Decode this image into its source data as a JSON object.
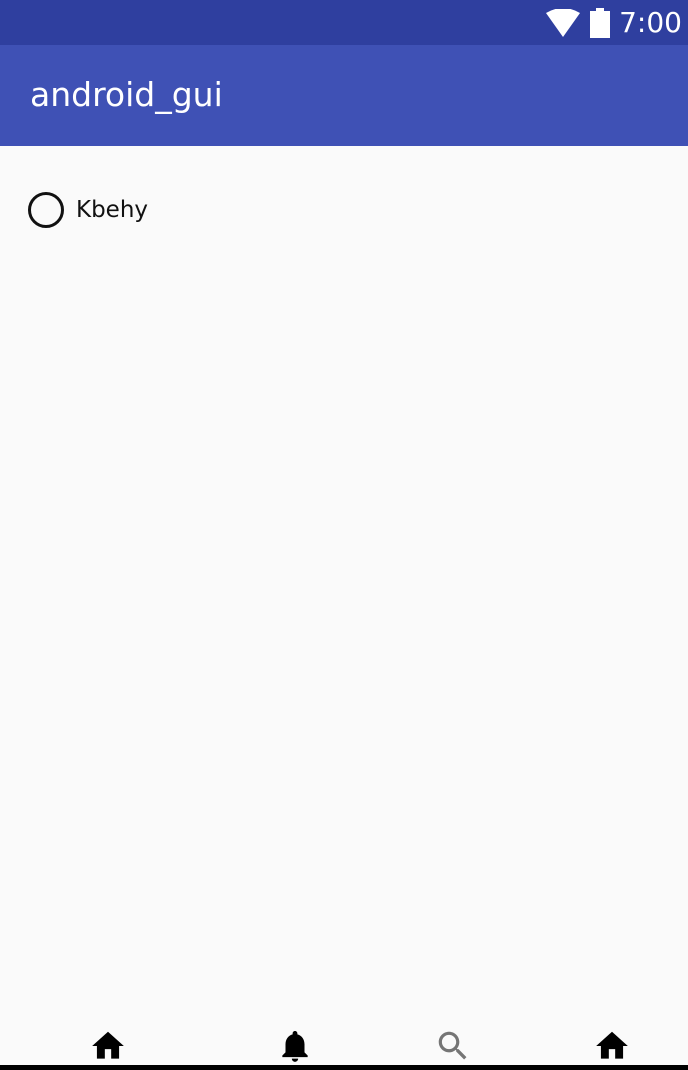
{
  "status_bar": {
    "time": "7:00",
    "icons": [
      "wifi-icon",
      "battery-icon"
    ],
    "background_color": "#2f3f9f"
  },
  "app_bar": {
    "title": "android_gui",
    "background_color": "#3f51b5"
  },
  "content": {
    "radio_options": [
      {
        "label": "Kbehy",
        "checked": false
      }
    ]
  },
  "bottom_nav": {
    "items": [
      {
        "icon": "home-icon",
        "color": "#000000"
      },
      {
        "icon": "bell-icon",
        "color": "#000000"
      },
      {
        "icon": "search-icon",
        "color": "#757575"
      },
      {
        "icon": "home-icon",
        "color": "#000000"
      }
    ]
  }
}
